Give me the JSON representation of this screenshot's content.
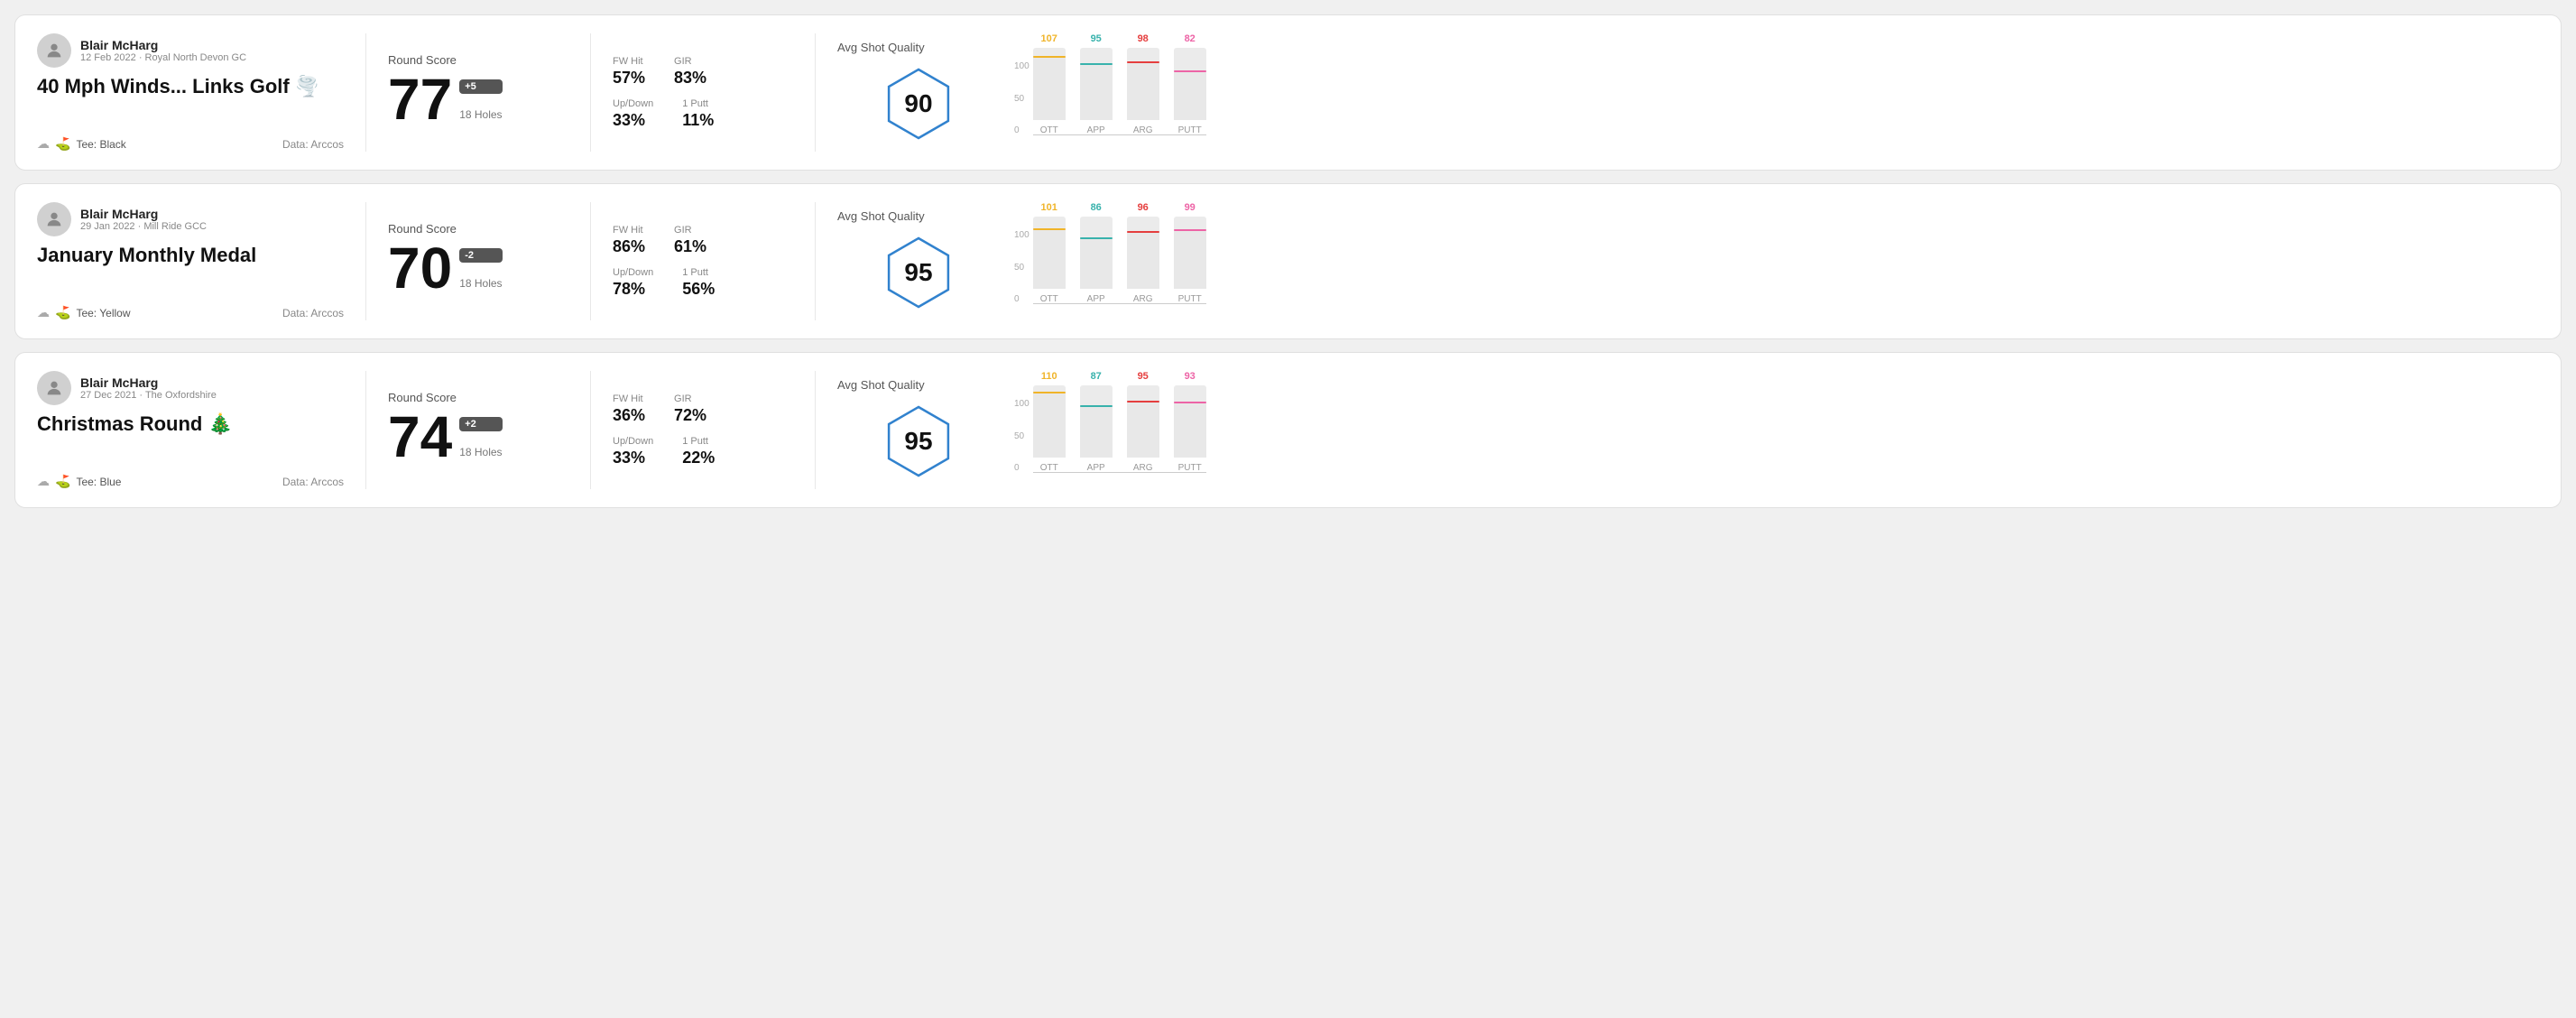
{
  "rounds": [
    {
      "id": "round-1",
      "user": {
        "name": "Blair McHarg",
        "meta": "12 Feb 2022 · Royal North Devon GC"
      },
      "title": "40 Mph Winds... Links Golf",
      "title_emoji": "🌪️",
      "tee": "Black",
      "data_source": "Data: Arccos",
      "score": {
        "label": "Round Score",
        "value": "77",
        "modifier": "+5",
        "holes": "18 Holes"
      },
      "stats": {
        "fw_hit_label": "FW Hit",
        "fw_hit_value": "57%",
        "gir_label": "GIR",
        "gir_value": "83%",
        "updown_label": "Up/Down",
        "updown_value": "33%",
        "oneputt_label": "1 Putt",
        "oneputt_value": "11%"
      },
      "quality": {
        "label": "Avg Shot Quality",
        "score": "90"
      },
      "chart": {
        "y_labels": [
          "100",
          "50",
          "0"
        ],
        "bars": [
          {
            "label": "OTT",
            "value": 107,
            "color": "#f0b429"
          },
          {
            "label": "APP",
            "value": 95,
            "color": "#38b2ac"
          },
          {
            "label": "ARG",
            "value": 98,
            "color": "#e53e3e"
          },
          {
            "label": "PUTT",
            "value": 82,
            "color": "#ed64a6"
          }
        ]
      }
    },
    {
      "id": "round-2",
      "user": {
        "name": "Blair McHarg",
        "meta": "29 Jan 2022 · Mill Ride GCC"
      },
      "title": "January Monthly Medal",
      "title_emoji": "",
      "tee": "Yellow",
      "data_source": "Data: Arccos",
      "score": {
        "label": "Round Score",
        "value": "70",
        "modifier": "-2",
        "holes": "18 Holes"
      },
      "stats": {
        "fw_hit_label": "FW Hit",
        "fw_hit_value": "86%",
        "gir_label": "GIR",
        "gir_value": "61%",
        "updown_label": "Up/Down",
        "updown_value": "78%",
        "oneputt_label": "1 Putt",
        "oneputt_value": "56%"
      },
      "quality": {
        "label": "Avg Shot Quality",
        "score": "95"
      },
      "chart": {
        "y_labels": [
          "100",
          "50",
          "0"
        ],
        "bars": [
          {
            "label": "OTT",
            "value": 101,
            "color": "#f0b429"
          },
          {
            "label": "APP",
            "value": 86,
            "color": "#38b2ac"
          },
          {
            "label": "ARG",
            "value": 96,
            "color": "#e53e3e"
          },
          {
            "label": "PUTT",
            "value": 99,
            "color": "#ed64a6"
          }
        ]
      }
    },
    {
      "id": "round-3",
      "user": {
        "name": "Blair McHarg",
        "meta": "27 Dec 2021 · The Oxfordshire"
      },
      "title": "Christmas Round",
      "title_emoji": "🎄",
      "tee": "Blue",
      "data_source": "Data: Arccos",
      "score": {
        "label": "Round Score",
        "value": "74",
        "modifier": "+2",
        "holes": "18 Holes"
      },
      "stats": {
        "fw_hit_label": "FW Hit",
        "fw_hit_value": "36%",
        "gir_label": "GIR",
        "gir_value": "72%",
        "updown_label": "Up/Down",
        "updown_value": "33%",
        "oneputt_label": "1 Putt",
        "oneputt_value": "22%"
      },
      "quality": {
        "label": "Avg Shot Quality",
        "score": "95"
      },
      "chart": {
        "y_labels": [
          "100",
          "50",
          "0"
        ],
        "bars": [
          {
            "label": "OTT",
            "value": 110,
            "color": "#f0b429"
          },
          {
            "label": "APP",
            "value": 87,
            "color": "#38b2ac"
          },
          {
            "label": "ARG",
            "value": 95,
            "color": "#e53e3e"
          },
          {
            "label": "PUTT",
            "value": 93,
            "color": "#ed64a6"
          }
        ]
      }
    }
  ]
}
